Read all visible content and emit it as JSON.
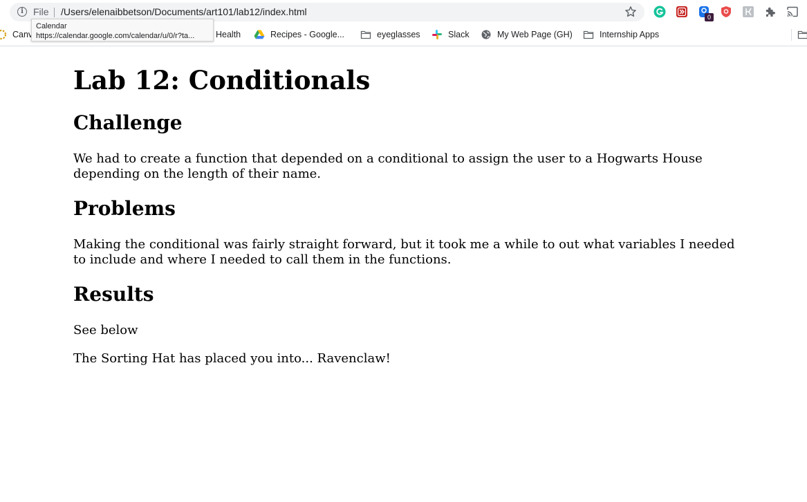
{
  "browser": {
    "address_bar": {
      "scheme_label": "File",
      "url": "/Users/elenaibbetson/Documents/art101/lab12/index.html"
    },
    "extensions": {
      "badge_count": "0"
    },
    "tooltip": {
      "title": "Calendar",
      "url": "https://calendar.google.com/calendar/u/0/r?ta..."
    },
    "bookmarks": [
      {
        "label": "Canva",
        "icon": "canvas-icon"
      },
      {
        "label": "Health",
        "icon": "health-icon"
      },
      {
        "label": "Recipes - Google...",
        "icon": "google-drive-icon"
      },
      {
        "label": "eyeglasses",
        "icon": "folder-icon"
      },
      {
        "label": "Slack",
        "icon": "slack-icon"
      },
      {
        "label": "My Web Page (GH)",
        "icon": "globe-icon"
      },
      {
        "label": "Internship Apps",
        "icon": "folder-icon"
      }
    ]
  },
  "page": {
    "title": "Lab 12: Conditionals",
    "sections": [
      {
        "heading": "Challenge",
        "body": "We had to create a function that depended on a conditional to assign the user to a Hogwarts House depending on the length of their name."
      },
      {
        "heading": "Problems",
        "body": "Making the conditional was fairly straight forward, but it took me a while to out what variables I needed to include and where I needed to call them in the functions."
      },
      {
        "heading": "Results",
        "body": "See below"
      }
    ],
    "output": "The Sorting Hat has placed you into... Ravenclaw!"
  },
  "colors": {
    "omnibox_bg": "#f1f3f4",
    "grammarly": "#15c39a",
    "red_extension": "#c5221f",
    "blue_extension": "#1a73e8"
  }
}
